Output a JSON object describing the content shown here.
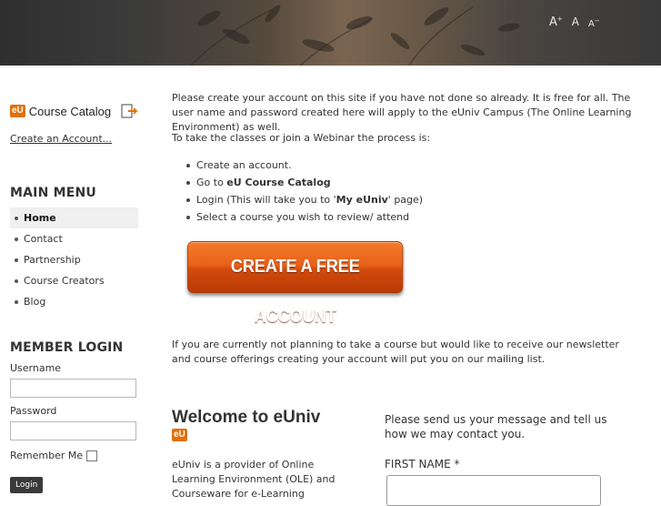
{
  "header": {
    "font_tools": {
      "large": "A",
      "large_sup": "+",
      "normal": "A",
      "small": "A",
      "small_sup": "−"
    }
  },
  "sidebar": {
    "catalog_badge": "eU",
    "catalog_title": "Course Catalog",
    "create_account_link": "Create an Account",
    "create_account_dots": "...",
    "main_menu_heading": "MAIN MENU",
    "menu_items": [
      {
        "label": "Home",
        "active": true
      },
      {
        "label": "Contact",
        "active": false
      },
      {
        "label": "Partnership",
        "active": false
      },
      {
        "label": "Course Creators",
        "active": false
      },
      {
        "label": "Blog",
        "active": false
      }
    ],
    "member_login_heading": "MEMBER LOGIN",
    "username_label": "Username",
    "password_label": "Password",
    "remember_label": "Remember Me",
    "login_button": "Login"
  },
  "main": {
    "intro": "Please create your account on this site if you have not done so already. It is free for all. The user name and password created here will apply to the eUniv Campus (The Online Learning Environment) as well.",
    "process_intro": "To take the classes or join a Webinar the process is:",
    "steps": {
      "s1": "Create an account.",
      "s2_prefix": "Go to ",
      "s2_bold": "eU Course Catalog",
      "s3_prefix": "Login (This will take you to '",
      "s3_bold": "My eUniv",
      "s3_suffix": "' page)",
      "s4": "Select a course you wish to review/ attend"
    },
    "cta_button": "CREATE A FREE ACCOUNT",
    "newsletter": "If you are currently not planning to take a course but would like to receive our newsletter and course offerings creating your account will put you on our mailing list.",
    "welcome_title": "Welcome to eUniv",
    "welcome_badge": "eU",
    "welcome_text": "eUniv is a provider of Online Learning Environment (OLE) and Courseware for e-Learning",
    "contact_intro": "Please send us your message and tell us how we may contact you.",
    "first_name_label": "FIRST NAME *"
  },
  "colors": {
    "accent_orange": "#e8621a",
    "badge_orange": "#e0700c",
    "header_dark": "#333333"
  }
}
